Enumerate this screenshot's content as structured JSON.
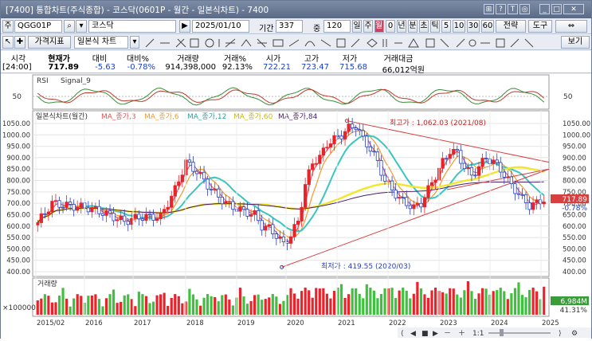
{
  "window": {
    "title": "[7400] 통합차트(주식종합) - 코스닥(0601P - 월간 - 일본식차트) - 7400"
  },
  "toolbar": {
    "label_ju": "주",
    "code": "QGG01P",
    "name": "코스닥",
    "date": "2025/01/10",
    "period_label": "기간",
    "period_value": "337",
    "count_label": "중",
    "count_value": "120",
    "period_tabs": [
      "일",
      "주",
      "월",
      "0",
      "년",
      "분",
      "초",
      "틱",
      "5",
      "10",
      "30",
      "60"
    ],
    "active_tab": "월",
    "extra_labels": [
      "전략",
      "도구"
    ]
  },
  "toolbar2": {
    "indicator_btn": "가격지표",
    "chart_type": "일본식 차트",
    "view_btn": "보기"
  },
  "info": {
    "headers": [
      "시각",
      "현재가",
      "대비",
      "대비%",
      "거래량",
      "거래%",
      "시가",
      "고가",
      "저가",
      "거래대금"
    ],
    "values": [
      "[24:00]",
      "717.89",
      "-5.63",
      "-0.78%",
      "914,398,000",
      "92.13%",
      "722.21",
      "723.47",
      "715.68",
      "66,012억원"
    ]
  },
  "rsi_panel": {
    "legend": [
      "RSI",
      "Signal_9"
    ],
    "axis_value": "50"
  },
  "price_panel": {
    "legend": [
      "일본식차트(월간)",
      "MA_종가,3",
      "MA_종가,6",
      "MA_종가,12",
      "MA_종가,60",
      "MA_종가,84"
    ],
    "y_ticks": [
      "1050.00",
      "1000.00",
      "950.00",
      "900.00",
      "850.00",
      "800.00",
      "750.00",
      "700.00",
      "650.00",
      "600.00",
      "550.00",
      "500.00",
      "450.00",
      "400.00"
    ],
    "high_label": "최고가 : 1,062.03 (2021/08)",
    "low_label": "최저가 : 419.55 (2020/03)",
    "current_price": "717.89",
    "current_change": "-0.78%",
    "colors": {
      "up": "#e8232b",
      "down": "#2a3fb5",
      "ma3": "#e94f4f",
      "ma6": "#f29a2e",
      "ma12": "#38c7c0",
      "ma60": "#f3e62a",
      "ma84": "#4b1e6e",
      "trend": "#d84040"
    }
  },
  "volume_panel": {
    "legend": "거래량",
    "left_label": "×100000",
    "current_value": "6,984M",
    "current_pct": "41.31%"
  },
  "x_axis": [
    "2015/02",
    "2016",
    "2017",
    "2018",
    "2019",
    "2020",
    "2021",
    "2022",
    "2023",
    "2024",
    "2025"
  ],
  "bottom_controls": [
    "1:1"
  ]
}
